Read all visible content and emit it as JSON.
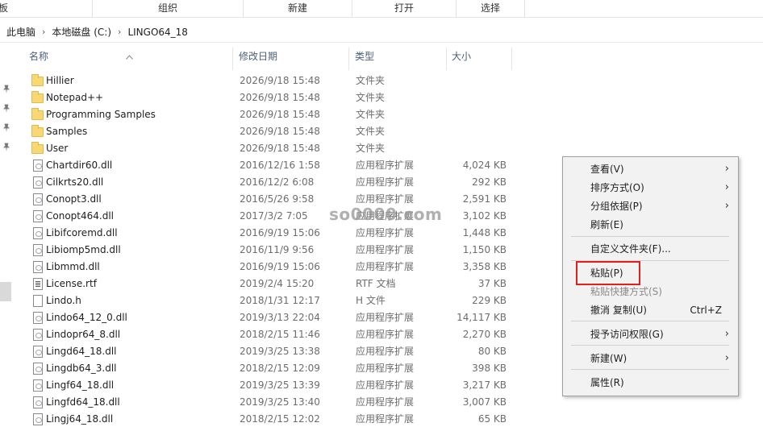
{
  "ribbon": {
    "groups": [
      "板",
      "组织",
      "新建",
      "打开",
      "选择"
    ]
  },
  "address": {
    "crumbs": [
      "此电脑",
      "本地磁盘 (C:)",
      "LINGO64_18"
    ],
    "separator": "›"
  },
  "columns": {
    "name": "名称",
    "date": "修改日期",
    "type": "类型",
    "size": "大小"
  },
  "files": [
    {
      "name": "Hillier",
      "date": "2026/9/18 15:48",
      "type": "文件夹",
      "size": "",
      "icon": "folder-icon"
    },
    {
      "name": "Notepad++",
      "date": "2026/9/18 15:48",
      "type": "文件夹",
      "size": "",
      "icon": "folder-icon"
    },
    {
      "name": "Programming Samples",
      "date": "2026/9/18 15:48",
      "type": "文件夹",
      "size": "",
      "icon": "folder-icon"
    },
    {
      "name": "Samples",
      "date": "2026/9/18 15:48",
      "type": "文件夹",
      "size": "",
      "icon": "folder-icon"
    },
    {
      "name": "User",
      "date": "2026/9/18 15:48",
      "type": "文件夹",
      "size": "",
      "icon": "folder-icon"
    },
    {
      "name": "Chartdir60.dll",
      "date": "2016/12/16 1:58",
      "type": "应用程序扩展",
      "size": "4,024 KB",
      "icon": "dll-file-icon"
    },
    {
      "name": "Cilkrts20.dll",
      "date": "2016/12/2 6:08",
      "type": "应用程序扩展",
      "size": "292 KB",
      "icon": "dll-file-icon"
    },
    {
      "name": "Conopt3.dll",
      "date": "2016/5/26 9:58",
      "type": "应用程序扩展",
      "size": "2,591 KB",
      "icon": "dll-file-icon"
    },
    {
      "name": "Conopt464.dll",
      "date": "2017/3/2 7:05",
      "type": "应用程序扩展",
      "size": "3,102 KB",
      "icon": "dll-file-icon"
    },
    {
      "name": "Libifcoremd.dll",
      "date": "2016/9/19 15:06",
      "type": "应用程序扩展",
      "size": "1,448 KB",
      "icon": "dll-file-icon"
    },
    {
      "name": "Libiomp5md.dll",
      "date": "2016/11/9 9:56",
      "type": "应用程序扩展",
      "size": "1,150 KB",
      "icon": "dll-file-icon"
    },
    {
      "name": "Libmmd.dll",
      "date": "2016/9/19 15:06",
      "type": "应用程序扩展",
      "size": "3,358 KB",
      "icon": "dll-file-icon"
    },
    {
      "name": "License.rtf",
      "date": "2019/2/4 15:20",
      "type": "RTF 文档",
      "size": "37 KB",
      "icon": "rtf-file-icon"
    },
    {
      "name": "Lindo.h",
      "date": "2018/1/31 12:17",
      "type": "H 文件",
      "size": "229 KB",
      "icon": "h-file-icon"
    },
    {
      "name": "Lindo64_12_0.dll",
      "date": "2019/3/13 22:04",
      "type": "应用程序扩展",
      "size": "14,117 KB",
      "icon": "dll-file-icon"
    },
    {
      "name": "Lindopr64_8.dll",
      "date": "2018/2/15 11:46",
      "type": "应用程序扩展",
      "size": "2,270 KB",
      "icon": "dll-file-icon"
    },
    {
      "name": "Lingd64_18.dll",
      "date": "2019/3/25 13:38",
      "type": "应用程序扩展",
      "size": "80 KB",
      "icon": "dll-file-icon"
    },
    {
      "name": "Lingdb64_3.dll",
      "date": "2018/2/15 12:09",
      "type": "应用程序扩展",
      "size": "398 KB",
      "icon": "dll-file-icon"
    },
    {
      "name": "Lingf64_18.dll",
      "date": "2019/3/25 13:39",
      "type": "应用程序扩展",
      "size": "3,217 KB",
      "icon": "dll-file-icon"
    },
    {
      "name": "Lingfd64_18.dll",
      "date": "2019/3/25 13:40",
      "type": "应用程序扩展",
      "size": "3,007 KB",
      "icon": "dll-file-icon"
    },
    {
      "name": "Lingj64_18.dll",
      "date": "2018/2/15 12:02",
      "type": "应用程序扩展",
      "size": "65 KB",
      "icon": "dll-file-icon"
    }
  ],
  "watermark": "so0000.com",
  "context_menu": {
    "items": [
      {
        "label": "查看(V)",
        "submenu": true
      },
      {
        "label": "排序方式(O)",
        "submenu": true
      },
      {
        "label": "分组依据(P)",
        "submenu": true
      },
      {
        "label": "刷新(E)"
      },
      {
        "label": "自定义文件夹(F)..."
      },
      {
        "label": "粘贴(P)",
        "highlighted": true
      },
      {
        "label": "粘贴快捷方式(S)",
        "disabled": true
      },
      {
        "label": "撤消 复制(U)",
        "accelerator": "Ctrl+Z"
      },
      {
        "label": "授予访问权限(G)",
        "submenu": true
      },
      {
        "label": "新建(W)",
        "submenu": true
      },
      {
        "label": "属性(R)"
      }
    ],
    "submenu_arrow": "›",
    "highlight_color": "#e02020"
  },
  "colors": {
    "folder": "#f8d775",
    "header_text": "#4c607a",
    "menu_bg": "#f2f2f2"
  }
}
